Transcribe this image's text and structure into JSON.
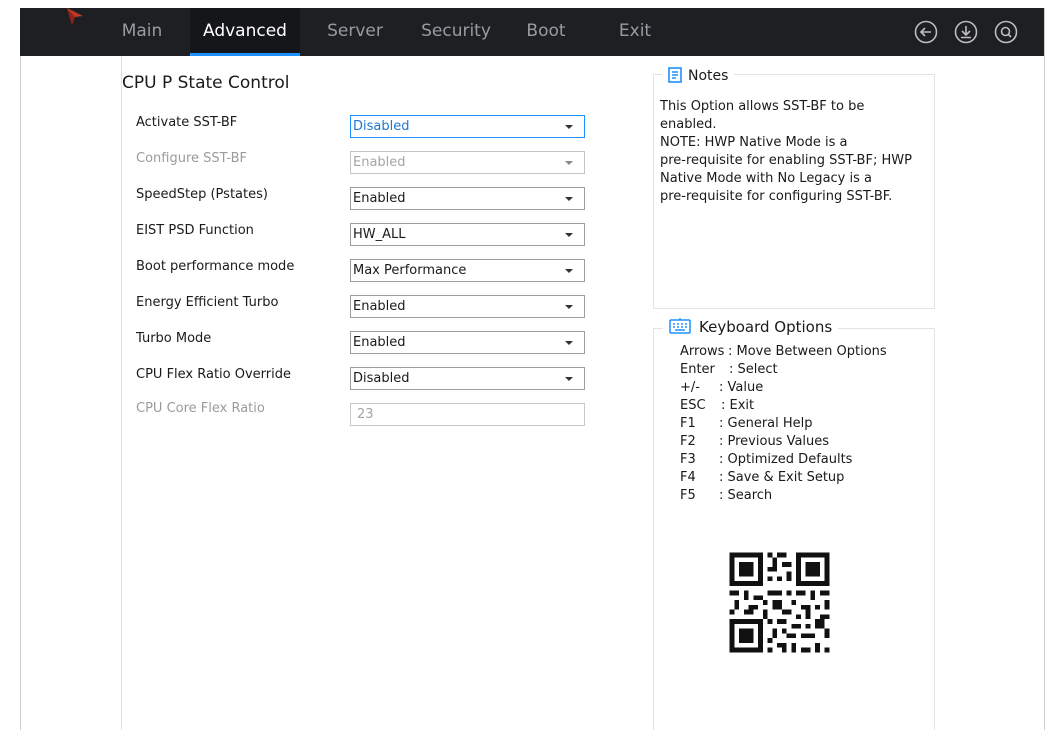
{
  "nav": {
    "tabs": [
      {
        "label": "Main"
      },
      {
        "label": "Advanced"
      },
      {
        "label": "Server"
      },
      {
        "label": "Security"
      },
      {
        "label": "Boot"
      },
      {
        "label": "Exit"
      }
    ],
    "active_tab": "Advanced"
  },
  "page": {
    "title": "CPU P State Control"
  },
  "settings": [
    {
      "label": "Activate SST-BF",
      "value": "Disabled",
      "state": "focused"
    },
    {
      "label": "Configure SST-BF",
      "value": "Enabled",
      "state": "disabled"
    },
    {
      "label": "SpeedStep (Pstates)",
      "value": "Enabled",
      "state": "normal"
    },
    {
      "label": "EIST PSD Function",
      "value": "HW_ALL",
      "state": "normal"
    },
    {
      "label": "Boot performance mode",
      "value": "Max Performance",
      "state": "normal"
    },
    {
      "label": "Energy Efficient Turbo",
      "value": "Enabled",
      "state": "normal"
    },
    {
      "label": "Turbo Mode",
      "value": "Enabled",
      "state": "normal"
    },
    {
      "label": "CPU Flex Ratio Override",
      "value": "Disabled",
      "state": "normal"
    },
    {
      "label": "CPU Core Flex Ratio",
      "value": "23",
      "state": "disabled"
    }
  ],
  "notes": {
    "title": "Notes",
    "lines": [
      "This Option allows SST-BF to be",
      "enabled.",
      "NOTE: HWP Native Mode is a",
      "pre-requisite for enabling SST-BF; HWP",
      "Native Mode with No Legacy is a",
      "pre-requisite for configuring SST-BF."
    ]
  },
  "keyboard": {
    "title": "Keyboard Options",
    "items": [
      {
        "key": "Arrows",
        "desc": ": Move Between Options"
      },
      {
        "key": "Enter",
        "desc": ": Select"
      },
      {
        "key": "+/-",
        "desc": ": Value"
      },
      {
        "key": "ESC",
        "desc": ": Exit"
      },
      {
        "key": "F1",
        "desc": ": General Help"
      },
      {
        "key": "F2",
        "desc": ": Previous Values"
      },
      {
        "key": "F3",
        "desc": ": Optimized Defaults"
      },
      {
        "key": "F4",
        "desc": ": Save & Exit Setup"
      },
      {
        "key": "F5",
        "desc": ": Search"
      }
    ]
  },
  "icons": {
    "back": "back-arrow-icon",
    "download": "download-icon",
    "search": "search-icon",
    "notes": "notes-icon",
    "keyboard": "keyboard-icon",
    "logo": "vendor-logo"
  },
  "colors": {
    "topbar": "#1e1f23",
    "accent": "#1e90ff",
    "logo": "#c0392b"
  }
}
